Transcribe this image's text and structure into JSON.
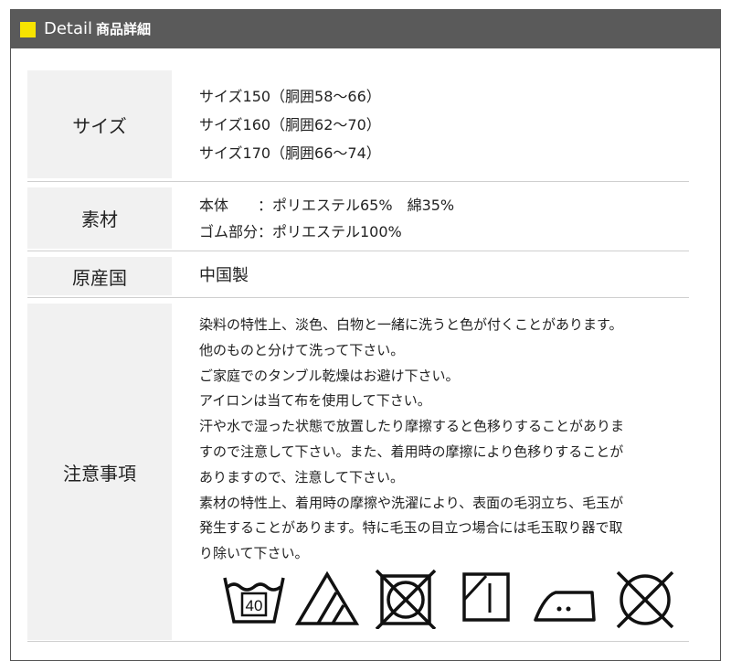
{
  "header": {
    "title": "Detail",
    "subtitle": "商品詳細",
    "accent_color": "#f7e300",
    "bar_color": "#5a5a5a"
  },
  "rows": {
    "size": {
      "label": "サイズ",
      "lines": [
        "サイズ150（胴囲58〜66）",
        "サイズ160（胴囲62〜70）",
        "サイズ170（胴囲66〜74）"
      ]
    },
    "material": {
      "label": "素材",
      "lines": [
        "本体　　：ポリエステル65%　綿35%",
        "ゴム部分：ポリエステル100%"
      ]
    },
    "origin": {
      "label": "原産国",
      "lines": [
        "中国製"
      ]
    },
    "caution": {
      "label": "注意事項",
      "lines": [
        "染料の特性上、淡色、白物と一緒に洗うと色が付くことがあります。",
        "他のものと分けて洗って下さい。",
        "ご家庭でのタンブル乾燥はお避け下さい。",
        "アイロンは当て布を使用して下さい。",
        "汗や水で湿った状態で放置したり摩擦すると色移りすることがありま",
        "すので注意して下さい。また、着用時の摩擦により色移りすることが",
        "ありますので、注意して下さい。",
        "素材の特性上、着用時の摩擦や洗濯により、表面の毛羽立ち、毛玉が",
        "発生することがあります。特に毛玉の目立つ場合には毛玉取り器で取",
        "り除いて下さい。"
      ]
    }
  },
  "care_icons": {
    "wash_temp": "40",
    "icons": [
      "wash-40-icon",
      "bleach-triangle-icon",
      "no-tumble-dry-icon",
      "line-dry-icon",
      "iron-medium-icon",
      "no-dry-clean-icon"
    ]
  }
}
